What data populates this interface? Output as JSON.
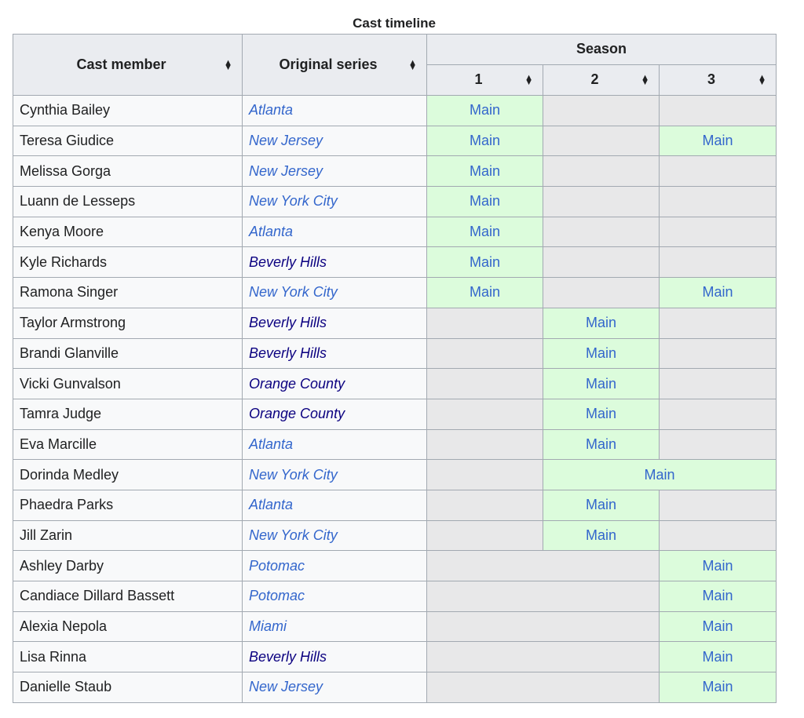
{
  "caption": "Cast timeline",
  "headers": {
    "cast_member": "Cast member",
    "original_series": "Original series",
    "season": "Season",
    "season_1": "1",
    "season_2": "2",
    "season_3": "3"
  },
  "main_label": "Main",
  "rows": [
    {
      "name": "Cynthia Bailey",
      "series": "Atlanta"
    },
    {
      "name": "Teresa Giudice",
      "series": "New Jersey"
    },
    {
      "name": "Melissa Gorga",
      "series": "New Jersey"
    },
    {
      "name": "Luann de Lesseps",
      "series": "New York City"
    },
    {
      "name": "Kenya Moore",
      "series": "Atlanta"
    },
    {
      "name": "Kyle Richards",
      "series": "Beverly Hills"
    },
    {
      "name": "Ramona Singer",
      "series": "New York City"
    },
    {
      "name": "Taylor Armstrong",
      "series": "Beverly Hills"
    },
    {
      "name": "Brandi Glanville",
      "series": "Beverly Hills"
    },
    {
      "name": "Vicki Gunvalson",
      "series": "Orange County"
    },
    {
      "name": "Tamra Judge",
      "series": "Orange County"
    },
    {
      "name": "Eva Marcille",
      "series": "Atlanta"
    },
    {
      "name": "Dorinda Medley",
      "series": "New York City"
    },
    {
      "name": "Phaedra Parks",
      "series": "Atlanta"
    },
    {
      "name": "Jill Zarin",
      "series": "New York City"
    },
    {
      "name": "Ashley Darby",
      "series": "Potomac"
    },
    {
      "name": "Candiace Dillard Bassett",
      "series": "Potomac"
    },
    {
      "name": "Alexia Nepola",
      "series": "Miami"
    },
    {
      "name": "Lisa Rinna",
      "series": "Beverly Hills"
    },
    {
      "name": "Danielle Staub",
      "series": "New Jersey"
    }
  ],
  "colors": {
    "main_bg": "#dcfcdc",
    "empty_bg": "#e8e8e9",
    "link": "#3366cc",
    "link_visited": "#0b0080"
  },
  "icons": {
    "sort": "sort-arrows-icon"
  }
}
